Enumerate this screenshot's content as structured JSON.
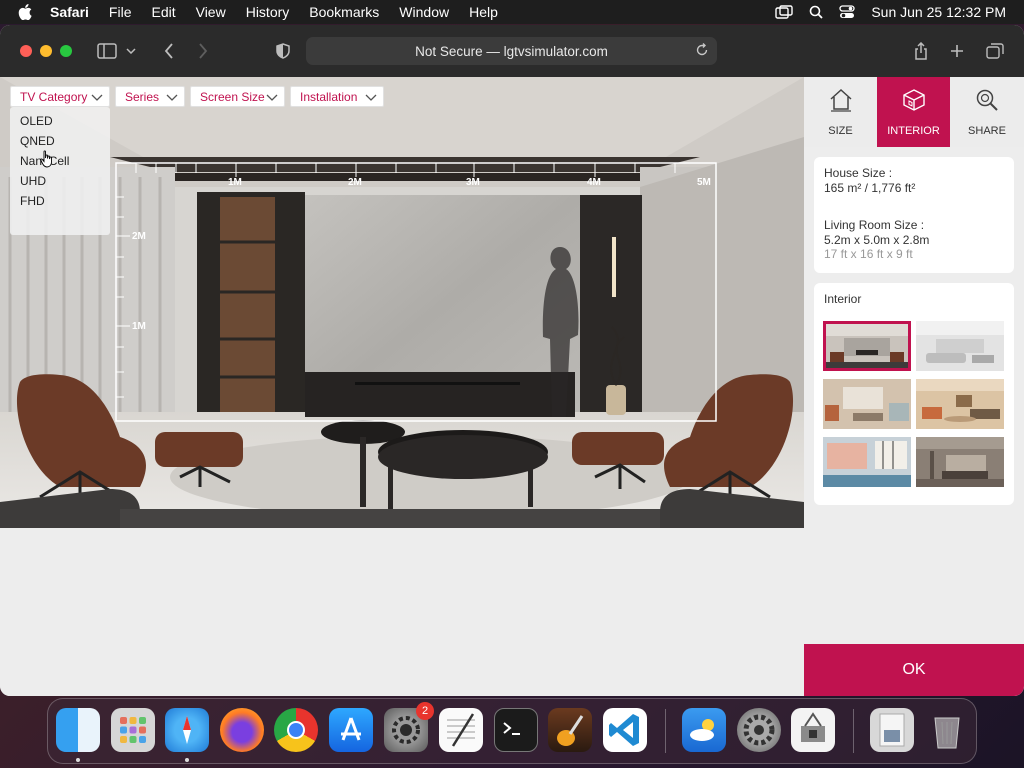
{
  "menubar": {
    "app_name": "Safari",
    "items": [
      "File",
      "Edit",
      "View",
      "History",
      "Bookmarks",
      "Window",
      "Help"
    ],
    "datetime": "Sun Jun 25  12:32 PM"
  },
  "browser": {
    "url_text": "Not Secure — lgtvsimulator.com"
  },
  "filters": {
    "tv_category": "TV Category",
    "series": "Series",
    "screen_size": "Screen Size",
    "installation": "Installation"
  },
  "tv_category_options": [
    "OLED",
    "QNED",
    "NanoCell",
    "UHD",
    "FHD"
  ],
  "ruler": {
    "horizontal": [
      "1M",
      "2M",
      "3M",
      "4M",
      "5M"
    ],
    "vertical": [
      "2M",
      "1M"
    ]
  },
  "side_tabs": {
    "size": "SIZE",
    "interior": "INTERIOR",
    "share": "SHARE"
  },
  "house_info": {
    "house_size_label": "House Size :",
    "house_size_value": "165 m² / 1,776 ft²",
    "living_room_label": "Living Room Size :",
    "living_room_metric": "5.2m x 5.0m x 2.8m",
    "living_room_imperial": "17 ft x 16 ft x 9 ft"
  },
  "interior": {
    "title": "Interior",
    "thumbnail_colors": [
      "#8a6f62",
      "#d9d9d9",
      "#b89a80",
      "#c8ab8a",
      "#9fb2bf",
      "#7d7268"
    ]
  },
  "ok_label": "OK",
  "dock": {
    "badge_count": "2"
  },
  "colors": {
    "accent": "#c0124f"
  }
}
